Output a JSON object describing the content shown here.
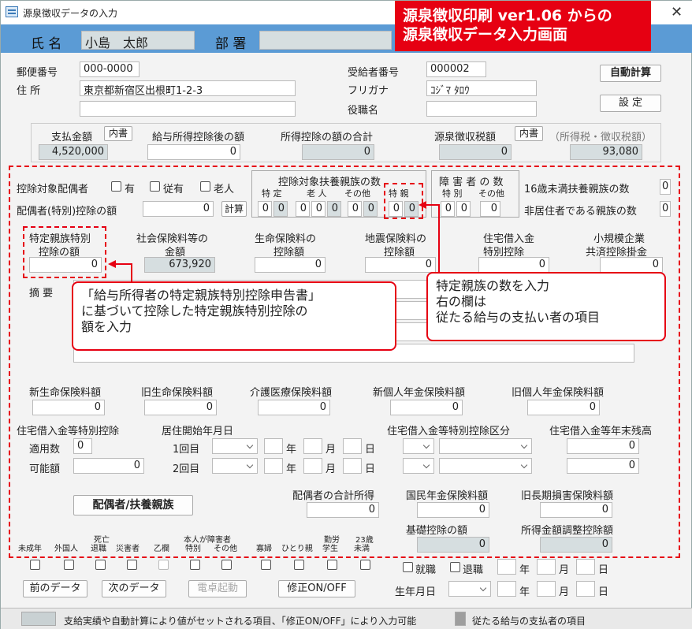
{
  "window": {
    "title": "源泉徴収データの入力",
    "close": "✕"
  },
  "banner": {
    "line1": "源泉徴収印刷 ver1.06 からの",
    "line2": "源泉徴収データ入力画面"
  },
  "header": {
    "name_label": "氏 名",
    "name_value": "小島　太郎",
    "dept_label": "部 署",
    "dept_value": ""
  },
  "address": {
    "postal_label": "郵便番号",
    "postal_value": "000-0000",
    "address_label": "住 所",
    "address_value": "東京都新宿区出根町1-2-3",
    "address2_value": "",
    "recipient_no_label": "受給者番号",
    "recipient_no_value": "000002",
    "furigana_label": "フリガナ",
    "furigana_value": "ｺｼﾞﾏ ﾀﾛｳ",
    "position_label": "役職名",
    "position_value": ""
  },
  "buttons": {
    "auto_calc": "自動計算",
    "settings": "設 定",
    "calc": "計算",
    "spouse_dependents": "配偶者/扶養親族",
    "prev": "前のデータ",
    "next": "次のデータ",
    "calculator": "電卓起動",
    "edit_toggle": "修正ON/OFF"
  },
  "summary": {
    "payment_label": "支払金額",
    "detail_btn": "内書",
    "payment_value": "4,520,000",
    "after_deduction_label": "給与所得控除後の額",
    "after_deduction_value": "0",
    "deduction_total_label": "所得控除の額の合計",
    "deduction_total_value": "0",
    "withholding_label": "源泉徴収税額",
    "withholding_detail": "内書",
    "withholding_value": "0",
    "income_tax_label": "（所得税・徴収税額）",
    "income_tax_value": "93,080"
  },
  "spouse": {
    "label": "控除対象配偶者",
    "opt_yes": "有",
    "opt_dependent": "従有",
    "opt_elderly": "老人",
    "deduction_label": "配偶者(特別)控除の額",
    "deduction_value": "0"
  },
  "dependents": {
    "title": "控除対象扶養親族の数",
    "col_special": "特 定",
    "col_elderly": "老 人",
    "col_other": "その他",
    "col_special2": "特 親",
    "values": [
      "0",
      "0",
      "0",
      "0",
      "0",
      "0",
      "0",
      "0",
      "0",
      "0"
    ]
  },
  "disabled": {
    "title": "障 害 者 の 数",
    "col_special": "特 別",
    "col_other": "その他",
    "values": [
      "0",
      "0",
      "0"
    ]
  },
  "minors": {
    "under16_label": "16歳未満扶養親族の数",
    "under16_value": "0",
    "nonresident_label": "非居住者である親族の数",
    "nonresident_value": "0"
  },
  "deductions": {
    "specified_label1": "特定親族特別",
    "specified_label2": "控除の額",
    "specified_value": "0",
    "social_label1": "社会保険料等の",
    "social_label2": "金額",
    "social_value": "673,920",
    "life_label1": "生命保険料の",
    "life_label2": "控除額",
    "life_value": "0",
    "earthquake_label1": "地震保険料の",
    "earthquake_label2": "控除額",
    "earthquake_value": "0",
    "housing_label1": "住宅借入金",
    "housing_label2": "特別控除",
    "housing_value": "0",
    "smallbiz_label1": "小規模企業",
    "smallbiz_label2": "共済控除掛金",
    "smallbiz_value": "0"
  },
  "remarks": {
    "label": "摘 要"
  },
  "insurance": {
    "new_life_label": "新生命保険料額",
    "new_life_value": "0",
    "old_life_label": "旧生命保険料額",
    "old_life_value": "0",
    "care_label": "介護医療保険料額",
    "care_value": "0",
    "new_pension_label": "新個人年金保険料額",
    "new_pension_value": "0",
    "old_pension_label": "旧個人年金保険料額",
    "old_pension_value": "0"
  },
  "housing_loan": {
    "title": "住宅借入金等特別控除",
    "applied_label": "適用数",
    "applied_value": "0",
    "possible_label": "可能額",
    "possible_value": "0",
    "start_label": "居住開始年月日",
    "first": "1回目",
    "second": "2回目",
    "year": "年",
    "month": "月",
    "day": "日",
    "category_label": "住宅借入金等特別控除区分",
    "balance_label": "住宅借入金等年末残高",
    "balance1": "0",
    "balance2": "0"
  },
  "other": {
    "spouse_income_label": "配偶者の合計所得",
    "spouse_income_value": "0",
    "national_pension_label": "国民年金保険料額",
    "national_pension_value": "0",
    "old_longterm_label": "旧長期損害保険料額",
    "old_longterm_value": "0",
    "basic_label": "基礎控除の額",
    "basic_value": "0",
    "income_adjust_label": "所得金額調整控除額",
    "income_adjust_value": "0"
  },
  "flags": {
    "minor": "未成年",
    "foreigner": "外国人",
    "death1": "死亡",
    "death2": "退職",
    "disabled": "災害者",
    "widow": "乙欄",
    "specialist1": "本人が障害者",
    "specialist2": "特別",
    "specialist3": "その他",
    "widow2": "寡婦",
    "single": "ひとり親",
    "student1": "勤労",
    "student2": "学生",
    "under23_1": "23歳",
    "under23_2": "未満",
    "hired": "就職",
    "retired": "退職",
    "birth_label": "生年月日",
    "year": "年",
    "month": "月",
    "day": "日"
  },
  "callouts": {
    "left_1": "「給与所得者の特定親族特別控除申告書」",
    "left_2": "に基づいて控除した特定親族特別控除の",
    "left_3": "額を入力",
    "right_1": "特定親族の数を入力",
    "right_2": "右の欄は",
    "right_3": "従たる給与の支払い者の項目"
  },
  "status": {
    "gray_text": "支給実績や自動計算により値がセットされる項目、「修正ON/OFF」により入力可能",
    "dark_text": "従たる給与の支払者の項目"
  },
  "colors": {
    "accent_red": "#e60012",
    "header_blue": "#5b9bd5",
    "readonly_gray": "#d6dee0"
  }
}
